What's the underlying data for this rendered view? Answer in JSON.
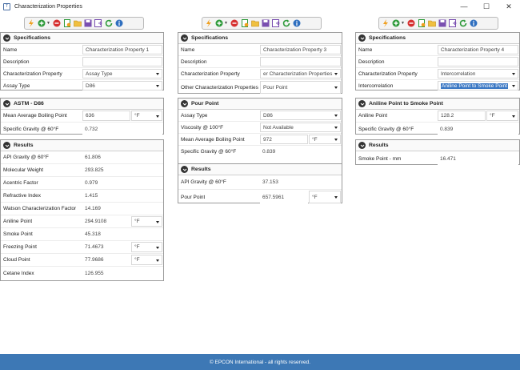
{
  "window": {
    "title": "Characterization Properties",
    "app_icon": "T",
    "controls": {
      "minimize": "—",
      "maximize": "☐",
      "close": "✕"
    }
  },
  "toolbar_icons": [
    "lightning-icon",
    "add-icon",
    "remove-icon",
    "new-document-icon",
    "open-folder-icon",
    "save-icon",
    "save-as-icon",
    "export-icon",
    "refresh-icon",
    "info-icon"
  ],
  "colors": {
    "footer": "#3d78b5",
    "selection": "#3b78c4",
    "accent_green": "#2e9a3a",
    "accent_red": "#d63030",
    "accent_orange": "#f0a020"
  },
  "col1": {
    "specifications": {
      "title": "Specifications",
      "name_label": "Name",
      "name_value": "Characterization Property 1",
      "description_label": "Description",
      "description_value": "",
      "char_prop_label": "Characterization Property",
      "char_prop_value": "Assay Type",
      "assay_type_label": "Assay Type",
      "assay_type_value": "D86"
    },
    "astm": {
      "title": "ASTM - D86",
      "mabp_label": "Mean Average Boiling Point",
      "mabp_value": "636",
      "mabp_unit": "°F",
      "sg_label": "Specific Gravity @ 60°F",
      "sg_value": "0.732"
    },
    "results": {
      "title": "Results",
      "rows": [
        {
          "label": "API Gravity @ 60°F",
          "value": "61.806",
          "unit": ""
        },
        {
          "label": "Molecular Weight",
          "value": "293.825",
          "unit": ""
        },
        {
          "label": "Acentric Factor",
          "value": "0.979",
          "unit": ""
        },
        {
          "label": "Refractive Index",
          "value": "1.415",
          "unit": ""
        },
        {
          "label": "Watson Characterization Factor",
          "value": "14.169",
          "unit": ""
        },
        {
          "label": "Aniline Point",
          "value": "294.9108",
          "unit": "°F"
        },
        {
          "label": "Smoke Point",
          "value": "45.318",
          "unit": ""
        },
        {
          "label": "Freezing Point",
          "value": "71.4673",
          "unit": "°F"
        },
        {
          "label": "Cloud Point",
          "value": "77.9686",
          "unit": "°F"
        },
        {
          "label": "Cetane Index",
          "value": "126.955",
          "unit": ""
        }
      ]
    }
  },
  "col2": {
    "specifications": {
      "title": "Specifications",
      "name_label": "Name",
      "name_value": "Characterization Property 3",
      "description_label": "Description",
      "description_value": "",
      "char_prop_label": "Characterization Property",
      "char_prop_value": "er Characterization Properties",
      "other_label": "Other Characterization Properties",
      "other_value": "Pour Point"
    },
    "pour_point": {
      "title": "Pour Point",
      "assay_label": "Assay Type",
      "assay_value": "D86",
      "visc_label": "Viscosity @ 100°F",
      "visc_value": "Not Available",
      "mabp_label": "Mean Average Boiling Point",
      "mabp_value": "972",
      "mabp_unit": "°F",
      "sg_label": "Specific Gravity @ 60°F",
      "sg_value": "0.839"
    },
    "results": {
      "title": "Results",
      "api_label": "API Gravity @ 60°F",
      "api_value": "37.153",
      "pp_label": "Pour Point",
      "pp_value": "657.5961",
      "pp_unit": "°F"
    }
  },
  "col3": {
    "specifications": {
      "title": "Specifications",
      "name_label": "Name",
      "name_value": "Characterization Property 4",
      "description_label": "Description",
      "description_value": "",
      "char_prop_label": "Characterization Property",
      "char_prop_value": "Intercorrelation",
      "inter_label": "Intercorrelation",
      "inter_value": "Aniline Point to Smoke Point"
    },
    "aniline": {
      "title": "Aniline Point to Smoke Point",
      "ap_label": "Aniline Point",
      "ap_value": "128.2",
      "ap_unit": "°F",
      "sg_label": "Specific Gravity @ 60°F",
      "sg_value": "0.839"
    },
    "results": {
      "title": "Results",
      "sp_label": "Smoke Point - mm",
      "sp_value": "16.471"
    }
  },
  "footer": {
    "text": "© EPCON International - all rights reserved."
  }
}
